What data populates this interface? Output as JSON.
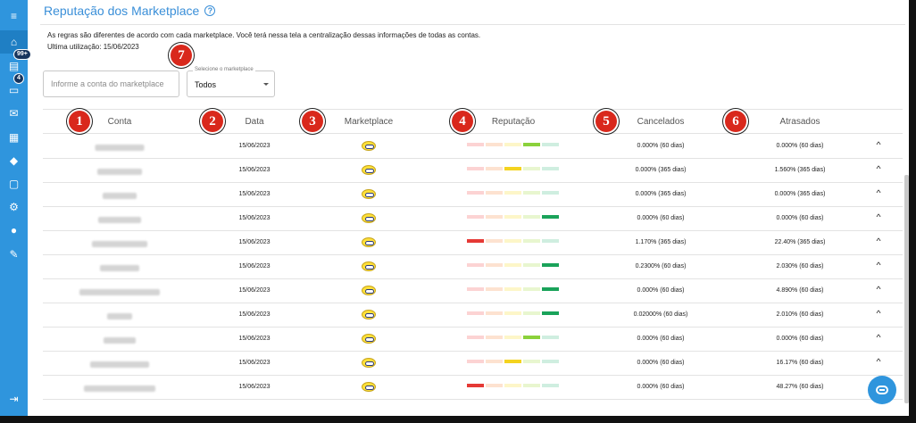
{
  "page": {
    "title": "Reputação dos Marketplace",
    "help_icon": "question-circle-icon",
    "description": "As regras são diferentes de acordo com cada marketplace. Você terá nessa tela a centralização dessas informações de todas as contas.",
    "last_use": "Ultima utilização: 15/06/2023"
  },
  "sidebar": {
    "items": [
      {
        "icon": "menu-icon",
        "glyph": "≡"
      },
      {
        "icon": "home-icon",
        "glyph": "⌂",
        "active": true
      },
      {
        "icon": "inbox-icon",
        "glyph": "▤",
        "badge": "99+"
      },
      {
        "icon": "chat-icon",
        "glyph": "▭",
        "badge": "4"
      },
      {
        "icon": "mail-icon",
        "glyph": "✉"
      },
      {
        "icon": "chart-icon",
        "glyph": "▦"
      },
      {
        "icon": "graduation-cap-icon",
        "glyph": "◆"
      },
      {
        "icon": "document-icon",
        "glyph": "▢"
      },
      {
        "icon": "gear-icon",
        "glyph": "⚙"
      },
      {
        "icon": "robot-icon",
        "glyph": "●"
      },
      {
        "icon": "wrench-icon",
        "glyph": "✎"
      },
      {
        "icon": "logout-icon",
        "glyph": "⇥"
      }
    ]
  },
  "filters": {
    "account_placeholder": "Informe a conta do marketplace",
    "marketplace_label": "Selecione o marketplace",
    "marketplace_value": "Todos"
  },
  "table": {
    "headers": {
      "conta": "Conta",
      "data": "Data",
      "marketplace": "Marketplace",
      "reputacao": "Reputação",
      "cancelados": "Cancelados",
      "atrasados": "Atrasados"
    },
    "rows": [
      {
        "date": "15/06/2023",
        "rep_level": 4,
        "cancelados": "0.000% (60 dias)",
        "atrasados": "0.000% (60 dias)",
        "expand": true
      },
      {
        "date": "15/06/2023",
        "rep_level": 3,
        "cancelados": "0.000% (365 dias)",
        "atrasados": "1.560% (365 dias)",
        "expand": true
      },
      {
        "date": "15/06/2023",
        "rep_level": 0,
        "cancelados": "0.000% (365 dias)",
        "atrasados": "0.000% (365 dias)",
        "expand": true
      },
      {
        "date": "15/06/2023",
        "rep_level": 5,
        "cancelados": "0.000% (60 dias)",
        "atrasados": "0.000% (60 dias)",
        "expand": true
      },
      {
        "date": "15/06/2023",
        "rep_level": 1,
        "cancelados": "1.170% (365 dias)",
        "atrasados": "22.40% (365 dias)",
        "expand": true
      },
      {
        "date": "15/06/2023",
        "rep_level": 5,
        "cancelados": "0.2300% (60 dias)",
        "atrasados": "2.030% (60 dias)",
        "expand": true
      },
      {
        "date": "15/06/2023",
        "rep_level": 5,
        "cancelados": "0.000% (60 dias)",
        "atrasados": "4.890% (60 dias)",
        "expand": true
      },
      {
        "date": "15/06/2023",
        "rep_level": 5,
        "cancelados": "0.02000% (60 dias)",
        "atrasados": "2.010% (60 dias)",
        "expand": true
      },
      {
        "date": "15/06/2023",
        "rep_level": 4,
        "cancelados": "0.000% (60 dias)",
        "atrasados": "0.000% (60 dias)",
        "expand": true
      },
      {
        "date": "15/06/2023",
        "rep_level": 3,
        "cancelados": "0.000% (60 dias)",
        "atrasados": "16.17% (60 dias)",
        "expand": true
      },
      {
        "date": "15/06/2023",
        "rep_level": 1,
        "cancelados": "0.000% (60 dias)",
        "atrasados": "48.27% (60 dias)",
        "expand": false
      }
    ]
  },
  "annotations": [
    "1",
    "2",
    "3",
    "4",
    "5",
    "6",
    "7"
  ],
  "colors": {
    "accent": "#2f95dd",
    "marker": "#d9281c",
    "rep_faded": [
      "#fcd3d3",
      "#fde2d0",
      "#fdf6c8",
      "#e8f6cf",
      "#cfeee0"
    ],
    "rep_active": [
      "#e53935",
      "#fb8c00",
      "#f4d31f",
      "#8bd13b",
      "#1aa35a"
    ]
  },
  "chat_widget": {
    "icon": "chat-bubble-icon"
  }
}
